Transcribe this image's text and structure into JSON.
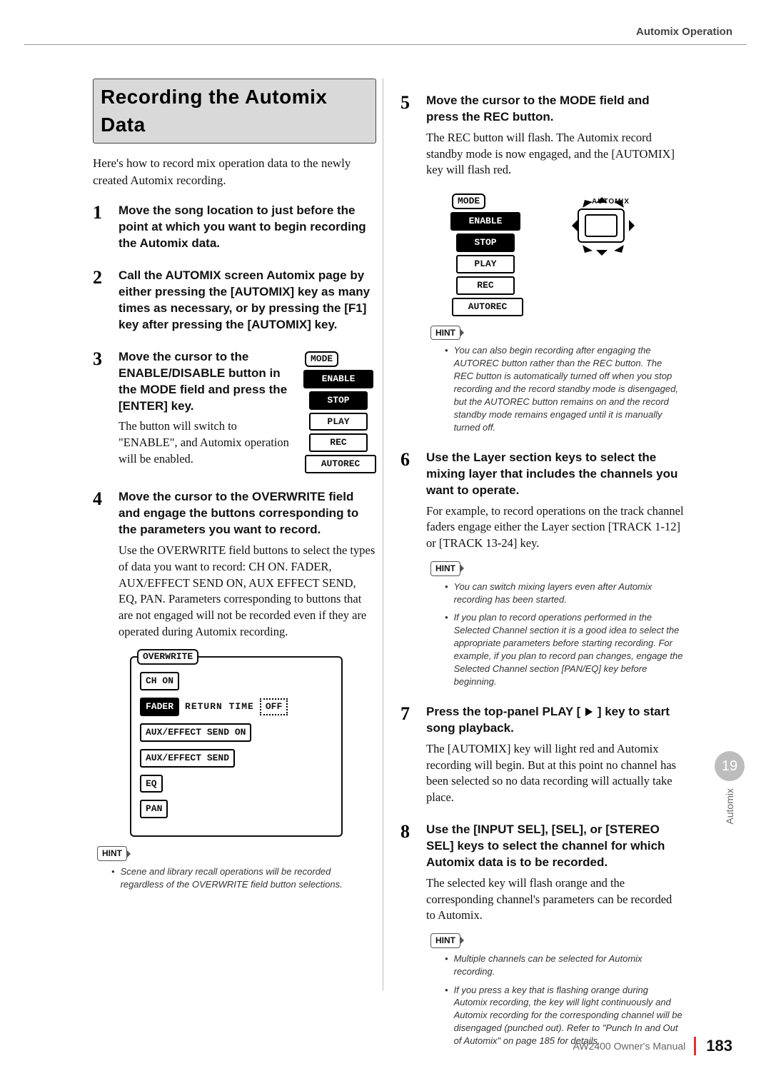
{
  "breadcrumb": "Automix Operation",
  "heading": "Recording the Automix Data",
  "intro": "Here's how to record mix operation data to the newly created Automix recording.",
  "left_steps": {
    "s1": {
      "title": "Move the song location to just before the point at which you want to begin recording the Automix data."
    },
    "s2": {
      "title": "Call the AUTOMIX screen Automix page by either pressing the [AUTOMIX] key as many times as necessary, or by pressing the [F1] key after pressing the [AUTOMIX] key."
    },
    "s3": {
      "title": "Move the cursor to the ENABLE/DISABLE button in the MODE field and press the [ENTER] key.",
      "body": "The button will switch to \"ENABLE\", and Automix operation will be enabled."
    },
    "s4": {
      "title": "Move the cursor to the OVERWRITE field and engage the buttons corresponding to the parameters you want to record.",
      "body": "Use the OVERWRITE field buttons to select the types of data you want to record: CH ON. FADER, AUX/EFFECT SEND ON, AUX EFFECT SEND, EQ, PAN. Parameters corresponding to buttons that are not engaged will not be recorded even if they are operated during Automix recording."
    }
  },
  "mode_panel": {
    "tab": "MODE",
    "enable": "ENABLE",
    "stop": "STOP",
    "play": "PLAY",
    "rec": "REC",
    "autorec": "AUTOREC"
  },
  "overwrite_panel": {
    "tab": "OVERWRITE",
    "ch_on": "CH ON",
    "fader": "FADER",
    "return_time_label": "RETURN TIME",
    "return_time_value": "OFF",
    "aux_send_on": "AUX/EFFECT SEND ON",
    "aux_send": "AUX/EFFECT SEND",
    "eq": "EQ",
    "pan": "PAN"
  },
  "hint1": {
    "label": "HINT",
    "b1": "Scene and library recall operations will be recorded regardless of the OVERWRITE field button selections."
  },
  "right_steps": {
    "s5": {
      "title": "Move the cursor to the MODE field and press the REC button.",
      "body": "The REC button will flash. The Automix record standby mode is now engaged, and the [AUTOMIX] key will flash red."
    },
    "s6": {
      "title": "Use the Layer section keys to select the mixing layer that includes the channels you want to operate.",
      "body": "For example, to record operations on the track channel faders engage either the Layer section [TRACK 1-12] or [TRACK 13-24] key."
    },
    "s7": {
      "title_prefix": "Press the top-panel PLAY [",
      "title_suffix": "] key to start song playback.",
      "body": "The [AUTOMIX] key will light red and Automix recording will begin. But at this point no channel has been selected so no data recording will actually take place."
    },
    "s8": {
      "title": "Use the [INPUT SEL], [SEL], or [STEREO SEL] keys to select the channel for which Automix data is to be recorded.",
      "body": "The selected key will flash orange and the corresponding channel's parameters can be recorded to Automix."
    }
  },
  "automix_label": "AUTOMIX",
  "hint2": {
    "label": "HINT",
    "b1": "You can also begin recording after engaging the AUTOREC button rather than the REC button. The REC button is automatically turned off when you stop recording and the record standby mode is disengaged, but the AUTOREC button remains on and the record standby mode remains engaged until it is manually turned off."
  },
  "hint3": {
    "label": "HINT",
    "b1": "You can switch mixing layers even after Automix recording has been started.",
    "b2": "If you plan to record operations performed in the Selected Channel section it is a good idea to select the appropriate parameters before starting recording. For example, if you plan to record pan changes, engage the Selected Channel section [PAN/EQ] key before beginning."
  },
  "hint4": {
    "label": "HINT",
    "b1": "Multiple channels can be selected for Automix recording.",
    "b2": "If you press a key that is flashing orange during Automix recording, the key will light continuously and Automix recording for the corresponding channel will be disengaged (punched out). Refer to \"Punch In and Out of Automix\" on page 185 for details."
  },
  "side": {
    "chapter": "19",
    "label": "Automix"
  },
  "footer": {
    "left": "AW2400  Owner's Manual",
    "page": "183"
  }
}
